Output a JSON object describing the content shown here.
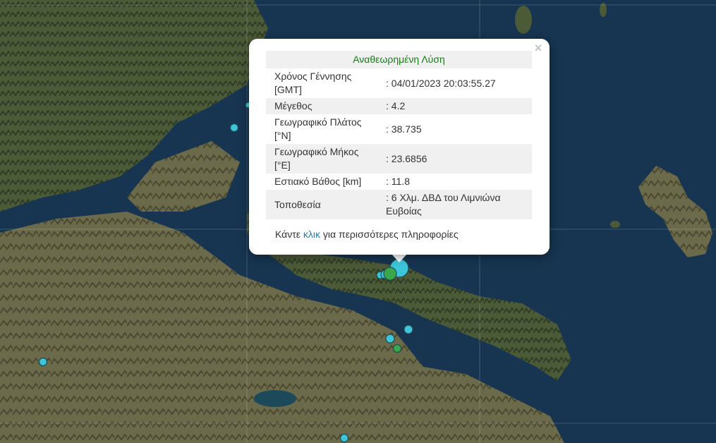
{
  "popup": {
    "title": "Αναθεωρημένη Λύση",
    "close_label": "×",
    "rows": [
      {
        "label": "Χρόνος Γέννησης [GMT]",
        "value": ": 04/01/2023 20:03:55.27"
      },
      {
        "label": "Μέγεθος",
        "value": ": 4.2"
      },
      {
        "label": "Γεωγραφικό Πλάτος [°N]",
        "value": ": 38.735"
      },
      {
        "label": "Γεωγραφικό Μήκος [°E]",
        "value": ": 23.6856"
      },
      {
        "label": "Εστιακό Βάθος [km]",
        "value": ": 11.8"
      },
      {
        "label": "Τοποθεσία",
        "value": ": 6 Χλμ. ΔΒΔ του Λιμνιώνα Ευβοίας"
      }
    ],
    "more_prefix": "Κάντε ",
    "more_link": "κλικ",
    "more_suffix": " για περισσότερες πληροφορίες",
    "title_color": "#1a7a1a",
    "link_color": "#1f7fa0"
  },
  "map": {
    "basemap": "satellite imagery",
    "marker_colors": {
      "cyan": "#3ec5d9",
      "green": "#3aa84a"
    }
  }
}
